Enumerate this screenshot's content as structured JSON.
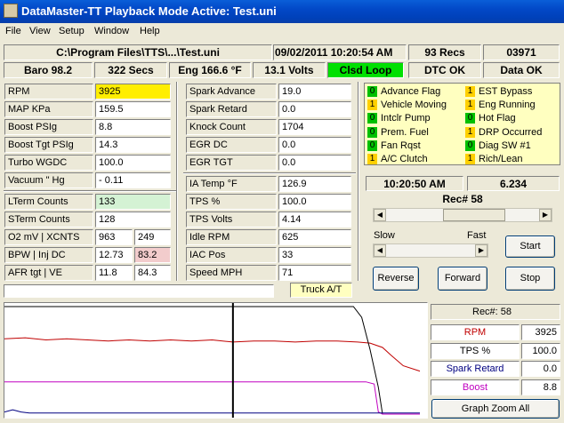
{
  "window": {
    "title": "DataMaster-TT  Playback Mode Active: Test.uni"
  },
  "menu": [
    "File",
    "View",
    "Setup",
    "Window",
    "Help"
  ],
  "status": {
    "path": "C:\\Program Files\\TTS\\...\\Test.uni",
    "datetime": "09/02/2011   10:20:54 AM",
    "recs": "93 Recs",
    "id": "03971",
    "baro": "Baro  98.2",
    "secs": "322 Secs",
    "eng": "Eng  166.6 °F",
    "volts": "13.1 Volts",
    "loop": "Clsd Loop",
    "dtc": "DTC OK",
    "data": "Data OK"
  },
  "colors": {
    "loop_bg": "#00e000",
    "rpm_bg": "#ffee00",
    "lterm_bg": "#d4f2d4",
    "injdc_bg": "#f2cccc"
  },
  "left_params": [
    {
      "label": "RPM",
      "value": "3925"
    },
    {
      "label": "MAP KPa",
      "value": "159.5"
    },
    {
      "label": "Boost PSIg",
      "value": "8.8"
    },
    {
      "label": "Boost Tgt PSIg",
      "value": "14.3"
    },
    {
      "label": "Turbo WGDC",
      "value": "100.0"
    },
    {
      "label": "Vacuum  \" Hg",
      "value": "- 0.11"
    }
  ],
  "left_params2": [
    {
      "label": "LTerm Counts",
      "value": "133"
    },
    {
      "label": "STerm Counts",
      "value": "128"
    }
  ],
  "left_pairs": [
    {
      "label": "O2 mV  |  XCNTS",
      "v1": "963",
      "v2": "249"
    },
    {
      "label": "BPW    |  Inj DC",
      "v1": "12.73",
      "v2": "83.2"
    },
    {
      "label": "AFR tgt  |  VE",
      "v1": "11.8",
      "v2": "84.3"
    }
  ],
  "mid_params": [
    {
      "label": "Spark Advance",
      "value": "19.0"
    },
    {
      "label": "Spark Retard",
      "value": "0.0"
    },
    {
      "label": "Knock Count",
      "value": "1704"
    },
    {
      "label": "EGR DC",
      "value": "0.0"
    },
    {
      "label": "EGR TGT",
      "value": "0.0"
    }
  ],
  "mid_params2": [
    {
      "label": "IA Temp °F",
      "value": "126.9"
    },
    {
      "label": "TPS %",
      "value": "100.0"
    },
    {
      "label": "TPS Volts",
      "value": "4.14"
    },
    {
      "label": "Idle RPM",
      "value": "625"
    },
    {
      "label": "IAC Pos",
      "value": "33"
    },
    {
      "label": "Speed MPH",
      "value": "71"
    }
  ],
  "truck_label": "Truck A/T",
  "flags": [
    {
      "v": "0",
      "label": "Advance Flag",
      "on": false
    },
    {
      "v": "1",
      "label": "EST Bypass",
      "on": true
    },
    {
      "v": "1",
      "label": "Vehicle Moving",
      "on": true
    },
    {
      "v": "1",
      "label": "Eng Running",
      "on": true
    },
    {
      "v": "0",
      "label": "Intclr Pump",
      "on": false
    },
    {
      "v": "0",
      "label": "Hot Flag",
      "on": false
    },
    {
      "v": "0",
      "label": "Prem. Fuel",
      "on": false
    },
    {
      "v": "1",
      "label": "DRP Occurred",
      "on": true
    },
    {
      "v": "0",
      "label": "Fan Rqst",
      "on": false
    },
    {
      "v": "0",
      "label": "Diag SW #1",
      "on": false
    },
    {
      "v": "1",
      "label": "A/C Clutch",
      "on": true
    },
    {
      "v": "1",
      "label": "Rich/Lean",
      "on": true
    }
  ],
  "playback": {
    "time": "10:20:50 AM",
    "elapsed": "6.234",
    "rec": "Rec# 58",
    "position": 0.62,
    "speed": 0.55,
    "slow": "Slow",
    "fast": "Fast",
    "start": "Start",
    "reverse": "Reverse",
    "forward": "Forward",
    "stop": "Stop"
  },
  "graph_panel": {
    "rec": "Rec#:  58",
    "rows": [
      {
        "label": "RPM",
        "value": "3925",
        "color": "#c00000"
      },
      {
        "label": "TPS %",
        "value": "100.0",
        "color": "#000000"
      },
      {
        "label": "Spark Retard",
        "value": "0.0",
        "color": "#000080"
      },
      {
        "label": "Boost",
        "value": "8.8",
        "color": "#c000c0"
      }
    ],
    "zoom": "Graph Zoom All"
  },
  "chart_data": {
    "type": "line",
    "series": [
      {
        "name": "RPM",
        "color": "#c00000",
        "points": [
          [
            0,
            0.3
          ],
          [
            0.05,
            0.29
          ],
          [
            0.1,
            0.31
          ],
          [
            0.15,
            0.3
          ],
          [
            0.2,
            0.31
          ],
          [
            0.25,
            0.32
          ],
          [
            0.3,
            0.31
          ],
          [
            0.35,
            0.32
          ],
          [
            0.4,
            0.31
          ],
          [
            0.45,
            0.32
          ],
          [
            0.5,
            0.31
          ],
          [
            0.55,
            0.33
          ],
          [
            0.6,
            0.32
          ],
          [
            0.65,
            0.32
          ],
          [
            0.7,
            0.33
          ],
          [
            0.75,
            0.32
          ],
          [
            0.8,
            0.32
          ],
          [
            0.85,
            0.33
          ],
          [
            0.88,
            0.34
          ],
          [
            0.91,
            0.38
          ],
          [
            0.93,
            0.45
          ],
          [
            0.96,
            0.55
          ],
          [
            1.0,
            0.6
          ]
        ]
      },
      {
        "name": "TPS %",
        "color": "#000000",
        "points": [
          [
            0,
            0.0
          ],
          [
            0.84,
            0.0
          ],
          [
            0.86,
            0.1
          ],
          [
            0.88,
            0.4
          ],
          [
            0.9,
            0.75
          ],
          [
            0.91,
            1.0
          ],
          [
            1.0,
            1.0
          ]
        ]
      },
      {
        "name": "Boost",
        "color": "#c000c0",
        "points": [
          [
            0,
            0.7
          ],
          [
            0.1,
            0.7
          ],
          [
            0.2,
            0.7
          ],
          [
            0.3,
            0.7
          ],
          [
            0.4,
            0.7
          ],
          [
            0.5,
            0.7
          ],
          [
            0.6,
            0.7
          ],
          [
            0.7,
            0.7
          ],
          [
            0.8,
            0.7
          ],
          [
            0.87,
            0.7
          ],
          [
            0.89,
            0.72
          ],
          [
            0.9,
            0.98
          ],
          [
            0.91,
            1.0
          ],
          [
            1.0,
            1.0
          ]
        ]
      },
      {
        "name": "Spark Retard",
        "color": "#000080",
        "points": [
          [
            0,
            0.98
          ],
          [
            0.02,
            0.96
          ],
          [
            0.04,
            0.98
          ],
          [
            0.06,
            0.99
          ],
          [
            0.1,
            0.99
          ],
          [
            1.0,
            0.99
          ]
        ]
      }
    ],
    "cursor": 0.55
  }
}
